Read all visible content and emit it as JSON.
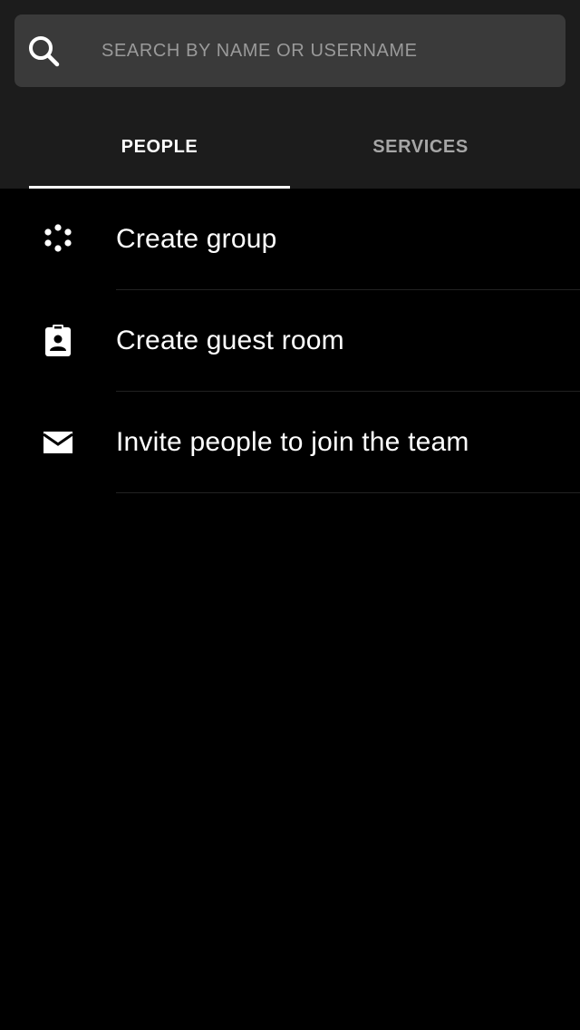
{
  "search": {
    "placeholder": "SEARCH BY NAME OR USERNAME",
    "icon": "search-icon"
  },
  "tabs": [
    {
      "label": "PEOPLE",
      "active": true
    },
    {
      "label": "SERVICES",
      "active": false
    }
  ],
  "actions": [
    {
      "label": "Create group",
      "icon": "group-dots-icon"
    },
    {
      "label": "Create guest room",
      "icon": "badge-icon"
    },
    {
      "label": "Invite people to join the team",
      "icon": "envelope-icon"
    }
  ],
  "colors": {
    "background": "#000000",
    "header": "#1c1c1c",
    "search_box": "#3a3a3a",
    "active_tab": "#ffffff",
    "inactive_tab": "#a6a6a6"
  }
}
